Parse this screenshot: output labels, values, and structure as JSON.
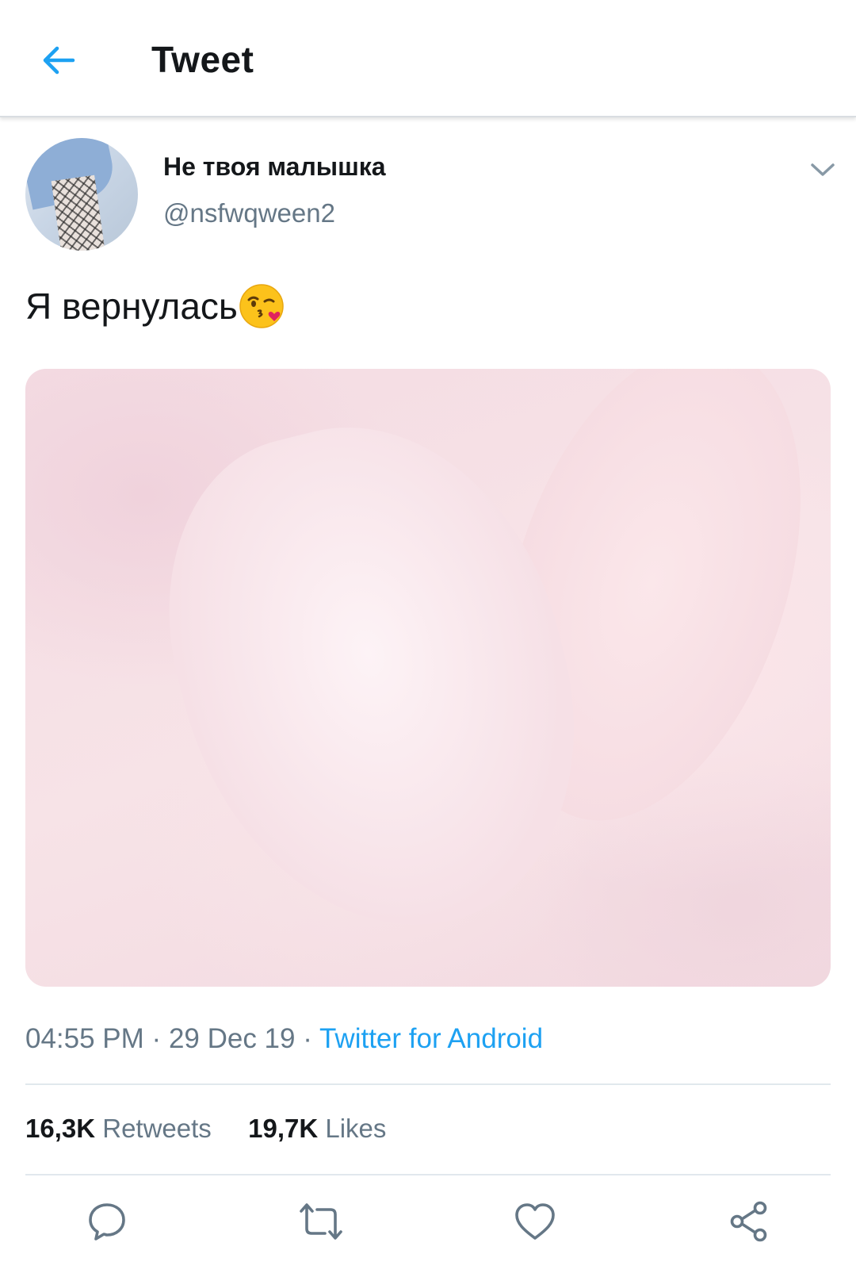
{
  "topbar": {
    "title": "Tweet",
    "back_icon": "arrow-left-icon",
    "accent_color": "#1da1f2"
  },
  "author": {
    "display_name": "Не твоя малышка",
    "handle": "@nsfwqween2",
    "menu_icon": "chevron-down-icon"
  },
  "tweet": {
    "text": "Я вернулась",
    "emoji": "face-blowing-kiss",
    "media": "photo"
  },
  "meta": {
    "time": "04:55 PM",
    "separator": "·",
    "date": "29 Dec 19",
    "source": "Twitter for Android"
  },
  "stats": {
    "retweets_count": "16,3K",
    "retweets_label": "Retweets",
    "likes_count": "19,7K",
    "likes_label": "Likes"
  },
  "actions": [
    {
      "name": "reply",
      "icon": "reply-icon"
    },
    {
      "name": "retweet",
      "icon": "retweet-icon"
    },
    {
      "name": "like",
      "icon": "heart-icon"
    },
    {
      "name": "share",
      "icon": "share-icon"
    }
  ],
  "colors": {
    "text_primary": "#14171a",
    "text_secondary": "#657786",
    "link": "#1da1f2",
    "divider": "#e1e8ed"
  }
}
